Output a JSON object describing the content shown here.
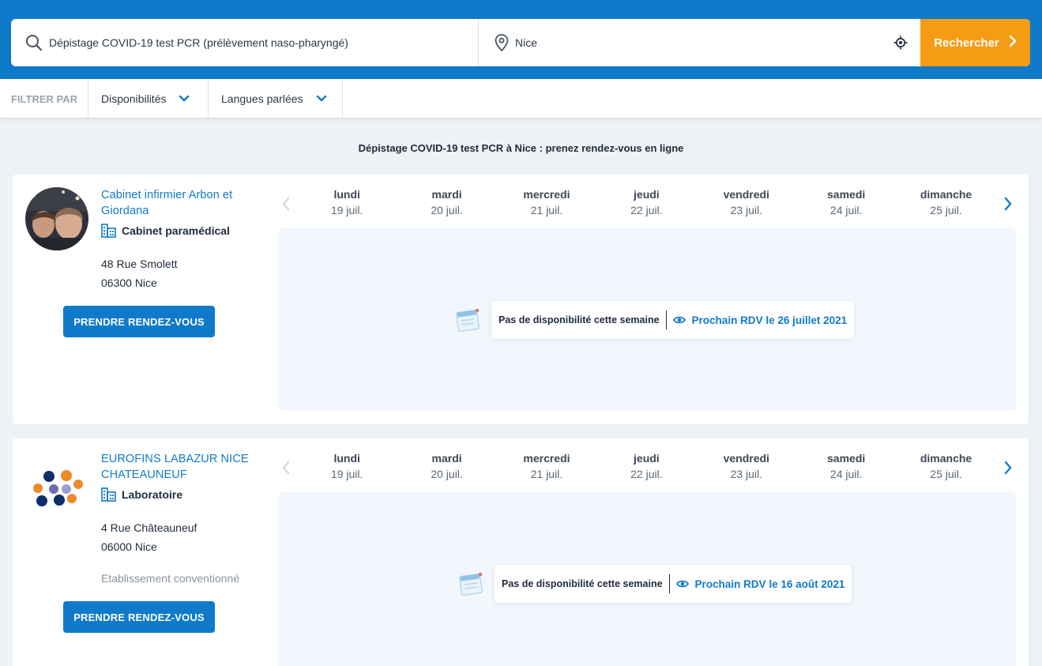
{
  "search": {
    "query_value": "Dépistage COVID-19 test PCR (prélèvement naso-pharyngé)",
    "place_value": "Nice",
    "button_label": "Rechercher",
    "search_icon": "search-icon",
    "place_icon": "map-pin-icon",
    "geolocate_icon": "crosshair-icon"
  },
  "filters": {
    "label": "FILTRER PAR",
    "items": [
      {
        "label": "Disponibilités"
      },
      {
        "label": "Langues parlées"
      }
    ]
  },
  "page": {
    "heading": "Dépistage COVID-19 test PCR à Nice : prenez rendez-vous en ligne"
  },
  "colors": {
    "brand_blue": "#107aca",
    "cta_orange": "#f59c14",
    "page_bg": "#eef1f5",
    "slots_bg": "#f1f7fc"
  },
  "days": [
    {
      "name": "lundi",
      "date": "19 juil."
    },
    {
      "name": "mardi",
      "date": "20 juil."
    },
    {
      "name": "mercredi",
      "date": "21 juil."
    },
    {
      "name": "jeudi",
      "date": "22 juil."
    },
    {
      "name": "vendredi",
      "date": "23 juil."
    },
    {
      "name": "samedi",
      "date": "24 juil."
    },
    {
      "name": "dimanche",
      "date": "25 juil."
    }
  ],
  "results": [
    {
      "name": "Cabinet infirmier Arbon et Giordana",
      "type": "Cabinet paramédical",
      "address_line1": "48 Rue Smolett",
      "address_line2": "06300 Nice",
      "book_label": "PRENDRE RENDEZ-VOUS",
      "no_availability": "Pas de disponibilité cette semaine",
      "next_appointment": "Prochain RDV le 26 juillet 2021"
    },
    {
      "name": "EUROFINS LABAZUR NICE CHATEAUNEUF",
      "type": "Laboratoire",
      "address_line1": "4 Rue Châteauneuf",
      "address_line2": "06000 Nice",
      "convention": "Etablissement conventionné",
      "book_label": "PRENDRE RENDEZ-VOUS",
      "no_availability": "Pas de disponibilité cette semaine",
      "next_appointment": "Prochain RDV le 16 août 2021"
    }
  ]
}
